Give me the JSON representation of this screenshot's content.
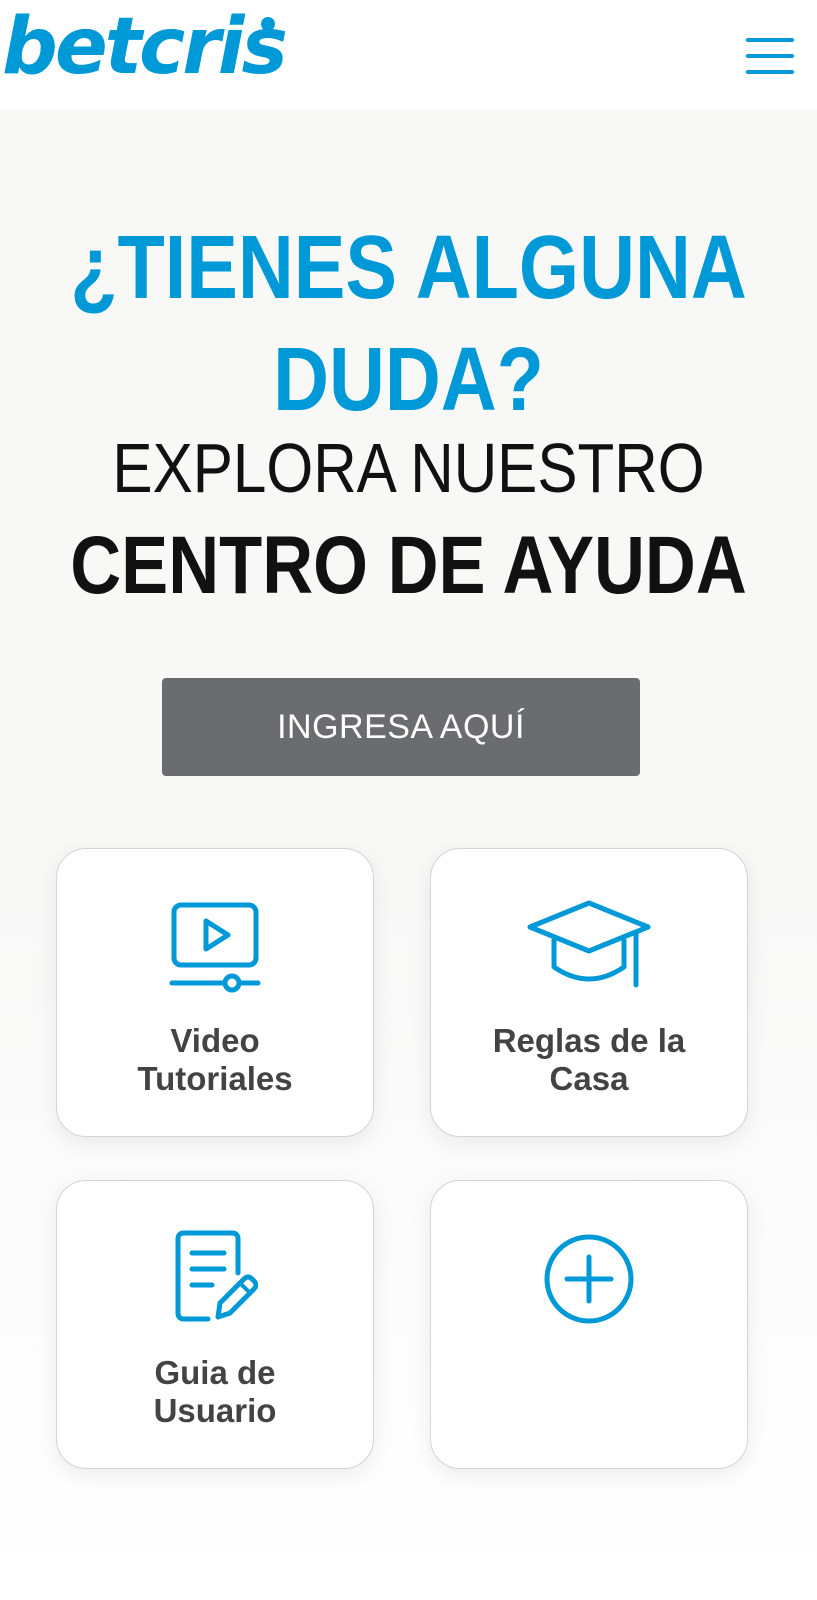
{
  "header": {
    "logo_text": "betcris",
    "menu_icon": "hamburger-menu-icon"
  },
  "hero": {
    "title": "¿TIENES ALGUNA\nDUDA?",
    "subtitle": "EXPLORA NUESTRO",
    "subtitle_strong": "CENTRO DE AYUDA",
    "cta_label": "INGRESA AQUÍ"
  },
  "cards": [
    {
      "label": "Video\nTutoriales",
      "icon": "video-player-icon"
    },
    {
      "label": "Reglas de la\nCasa",
      "icon": "graduation-cap-icon"
    },
    {
      "label": "Guia de\nUsuario",
      "icon": "document-edit-icon"
    },
    {
      "label": "",
      "icon": "plus-circle-icon"
    }
  ],
  "colors": {
    "brand_blue": "#0099d8",
    "button_gray": "#6b6c6f",
    "text_dark": "#111111",
    "card_text": "#434343",
    "hero_bg": "#f8f8f7"
  }
}
